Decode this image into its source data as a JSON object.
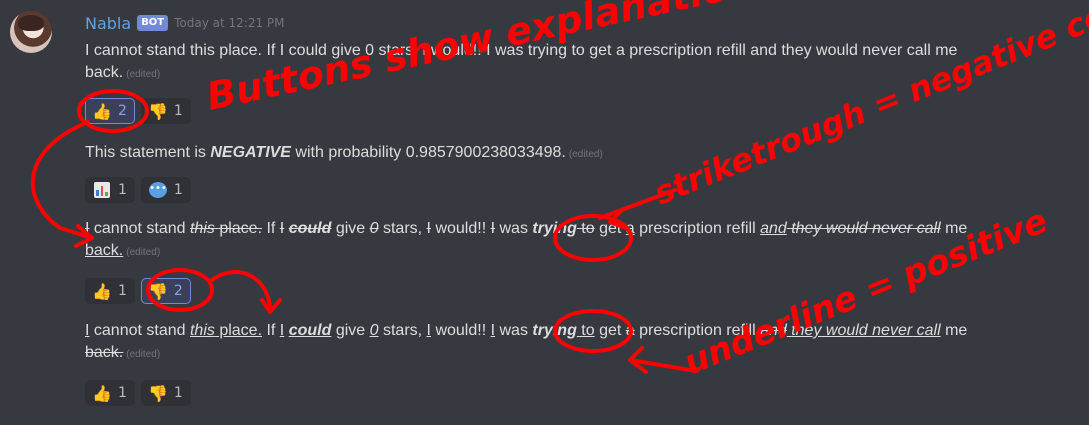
{
  "author": {
    "name": "Nabla",
    "tag": "BOT",
    "timestamp": "Today at 12:21 PM"
  },
  "edited_label": "(edited)",
  "messages": {
    "m1_line1": "I cannot stand this place. If I could give 0 stars, I would!! I was trying to get a prescription refill and they would never call me",
    "m1_line2": "back.",
    "m2": "This statement is ",
    "m2_strong": "NEGATIVE",
    "m2_tail": " with probability 0.9857900238033498."
  },
  "reactions": {
    "r1": [
      {
        "emoji": "thumbs-up",
        "count": "2",
        "active": true
      },
      {
        "emoji": "thumbs-down",
        "count": "1",
        "active": false
      }
    ],
    "r2": [
      {
        "emoji": "bar-chart",
        "count": "1"
      },
      {
        "emoji": "speech-bubble",
        "count": "1"
      }
    ],
    "r3": [
      {
        "emoji": "thumbs-up",
        "count": "1"
      },
      {
        "emoji": "thumbs-down",
        "count": "2"
      }
    ],
    "r4": [
      {
        "emoji": "thumbs-up",
        "count": "1"
      },
      {
        "emoji": "thumbs-down",
        "count": "1"
      }
    ]
  },
  "words": {
    "w_I": "I",
    "w_cannot_stand": " cannot stand ",
    "w_this": "this",
    "w_place": " place.",
    "w_if": " If ",
    "w_I2": "I",
    "w_could": "could",
    "w_give": " give ",
    "w_0": "0",
    "w_stars": " stars, ",
    "w_I3": "I",
    "w_would": " would!! ",
    "w_I4": "I",
    "w_was": " was ",
    "w_trying": "trying",
    "w_to": " to",
    "w_get": " get ",
    "w_a": "a",
    "w_prescription": " prescription refill ",
    "w_and": "and",
    "w_they": " they",
    "w_would2": " would",
    "w_never": " never",
    "w_call": " call",
    "w_me": " me",
    "w_back": "back."
  },
  "annotations": {
    "a1": "Buttons show explanation",
    "a2": "striketrough = negative correlation",
    "a3": "underline = positive"
  },
  "colors": {
    "annotation": "#ff0000",
    "background": "#36393f",
    "username": "#5ea4e6"
  }
}
